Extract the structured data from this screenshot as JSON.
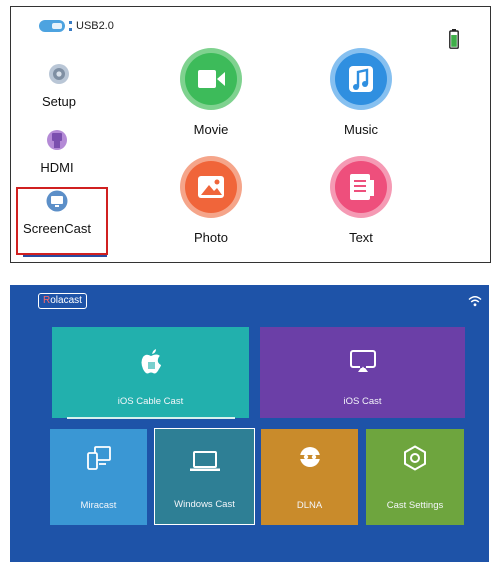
{
  "top_menu": {
    "usb_label": "USB2.0",
    "side_items": [
      {
        "label": "Setup",
        "icon": "gear-icon"
      },
      {
        "label": "HDMI",
        "icon": "hdmi-icon"
      },
      {
        "label": "ScreenCast",
        "icon": "monitor-icon",
        "selected": true
      }
    ],
    "apps": [
      {
        "label": "Movie",
        "icon": "video-camera-icon",
        "color": "#3dbb5a"
      },
      {
        "label": "Music",
        "icon": "music-note-icon",
        "color": "#2f8fe0"
      },
      {
        "label": "Photo",
        "icon": "image-icon",
        "color": "#f0653a"
      },
      {
        "label": "Text",
        "icon": "document-icon",
        "color": "#ee4f7c"
      }
    ],
    "colors": {
      "selection_border": "#d02020",
      "underline": "#2a4aa0"
    }
  },
  "cast_menu": {
    "brand": {
      "first_letter": "R",
      "rest": "olacast"
    },
    "tiles": [
      {
        "label": "iOS Cable Cast",
        "icon": "apple-icon",
        "color": "#22b0ad"
      },
      {
        "label": "iOS Cast",
        "icon": "airplay-icon",
        "color": "#6b3fa7"
      },
      {
        "label": "Miracast",
        "icon": "devices-icon",
        "color": "#3a97d4"
      },
      {
        "label": "Windows Cast",
        "icon": "laptop-icon",
        "color": "#2e7f95",
        "selected": true
      },
      {
        "label": "DLNA",
        "icon": "dlna-icon",
        "color": "#c98b2b"
      },
      {
        "label": "Cast Settings",
        "icon": "settings-icon",
        "color": "#6ea53e"
      }
    ],
    "background": "#1e53a8"
  }
}
